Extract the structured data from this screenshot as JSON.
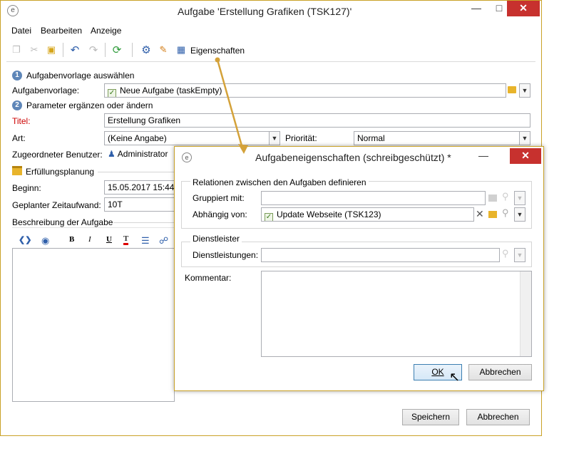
{
  "main_window": {
    "title": "Aufgabe 'Erstellung Grafiken (TSK127)'",
    "menu": [
      "Datei",
      "Bearbeiten",
      "Anzeige"
    ],
    "toolbar": {
      "properties_label": "Eigenschaften"
    },
    "step1": {
      "number": "1",
      "heading": "Aufgabenvorlage auswählen",
      "template_label": "Aufgabenvorlage:",
      "template_value": "Neue Aufgabe (taskEmpty)"
    },
    "step2": {
      "number": "2",
      "heading": "Parameter ergänzen oder ändern"
    },
    "title_label": "Titel:",
    "title_value": "Erstellung Grafiken",
    "type_label": "Art:",
    "type_value": "(Keine Angabe)",
    "priority_label": "Priorität:",
    "priority_value": "Normal",
    "assigned_label": "Zugeordneter Benutzer:",
    "assigned_value": "Administrator",
    "planning_heading": "Erfüllungsplanung",
    "start_label": "Beginn:",
    "start_value": "15.05.2017 15:44:28",
    "effort_label": "Geplanter Zeitaufwand:",
    "effort_value": "10T",
    "description_label": "Beschreibung der Aufgabe",
    "rte": {
      "bold": "B",
      "italic": "I",
      "underline": "U",
      "text": "T"
    },
    "save_label": "Speichern",
    "cancel_label": "Abbrechen"
  },
  "dialog": {
    "title": "Aufgabeneigenschaften (schreibgeschützt) *",
    "relations_heading": "Relationen zwischen den Aufgaben definieren",
    "grouped_label": "Gruppiert mit:",
    "grouped_value": "",
    "depends_label": "Abhängig von:",
    "depends_value": "Update Webseite (TSK123)",
    "provider_heading": "Dienstleister",
    "services_label": "Dienstleistungen:",
    "services_value": "",
    "comment_label": "Kommentar:",
    "comment_value": "",
    "ok_label": "OK",
    "cancel_label": "Abbrechen"
  },
  "colors": {
    "border": "#c9a227",
    "close": "#c7312e",
    "required_label": "#cc0000",
    "arrow": "#d4a23a"
  }
}
